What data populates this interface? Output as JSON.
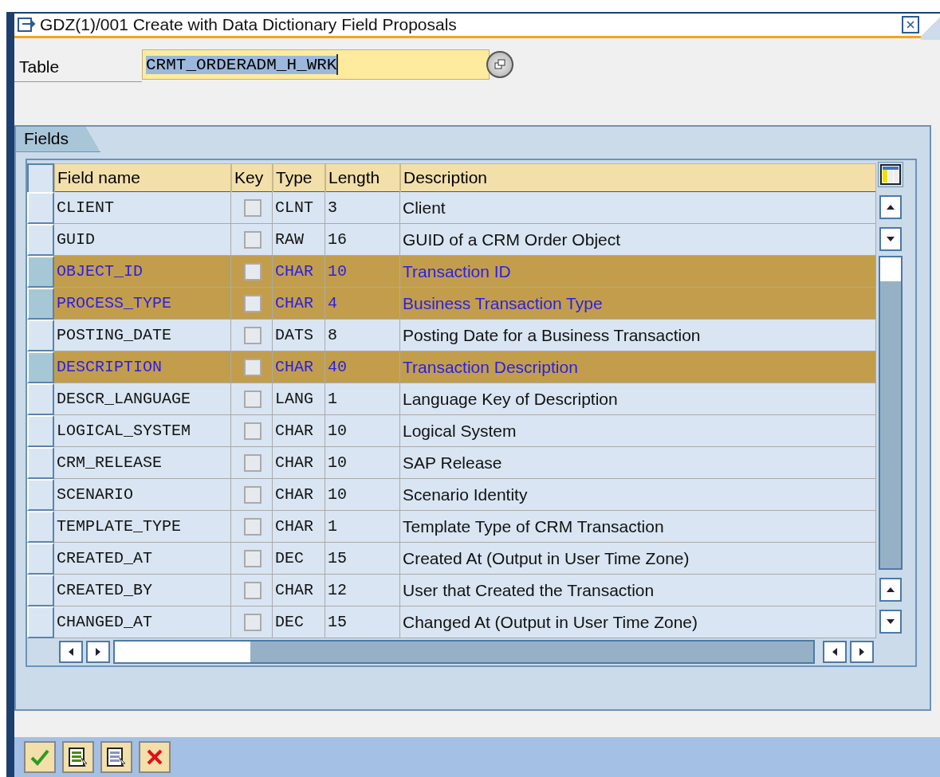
{
  "window": {
    "title": "GDZ(1)/001 Create with Data Dictionary Field Proposals"
  },
  "table_field": {
    "label": "Table",
    "value": "CRMT_ORDERADM_H_WRK",
    "value_selected": true
  },
  "group": {
    "tab": "Fields"
  },
  "columns": [
    "Field name",
    "Key",
    "Type",
    "Length",
    "Description"
  ],
  "rows": [
    {
      "field": "CLIENT",
      "key": false,
      "type": "CLNT",
      "length": "3",
      "description": "Client",
      "selected": false
    },
    {
      "field": "GUID",
      "key": false,
      "type": "RAW",
      "length": "16",
      "description": "GUID of a CRM Order Object",
      "selected": false
    },
    {
      "field": "OBJECT_ID",
      "key": false,
      "type": "CHAR",
      "length": "10",
      "description": "Transaction ID",
      "selected": true
    },
    {
      "field": "PROCESS_TYPE",
      "key": false,
      "type": "CHAR",
      "length": "4",
      "description": "Business Transaction Type",
      "selected": true
    },
    {
      "field": "POSTING_DATE",
      "key": false,
      "type": "DATS",
      "length": "8",
      "description": "Posting Date for a Business Transaction",
      "selected": false
    },
    {
      "field": "DESCRIPTION",
      "key": false,
      "type": "CHAR",
      "length": "40",
      "description": "Transaction Description",
      "selected": true
    },
    {
      "field": "DESCR_LANGUAGE",
      "key": false,
      "type": "LANG",
      "length": "1",
      "description": "Language Key of Description",
      "selected": false
    },
    {
      "field": "LOGICAL_SYSTEM",
      "key": false,
      "type": "CHAR",
      "length": "10",
      "description": "Logical System",
      "selected": false
    },
    {
      "field": "CRM_RELEASE",
      "key": false,
      "type": "CHAR",
      "length": "10",
      "description": "SAP Release",
      "selected": false
    },
    {
      "field": "SCENARIO",
      "key": false,
      "type": "CHAR",
      "length": "10",
      "description": "Scenario Identity",
      "selected": false
    },
    {
      "field": "TEMPLATE_TYPE",
      "key": false,
      "type": "CHAR",
      "length": "1",
      "description": "Template Type of CRM Transaction",
      "selected": false
    },
    {
      "field": "CREATED_AT",
      "key": false,
      "type": "DEC",
      "length": "15",
      "description": "Created At (Output in User Time Zone)",
      "selected": false
    },
    {
      "field": "CREATED_BY",
      "key": false,
      "type": "CHAR",
      "length": "12",
      "description": "User that Created the Transaction",
      "selected": false
    },
    {
      "field": "CHANGED_AT",
      "key": false,
      "type": "DEC",
      "length": "15",
      "description": "Changed At (Output in User Time Zone)",
      "selected": false
    }
  ],
  "footer_buttons": [
    {
      "kind": "confirm"
    },
    {
      "kind": "select-all"
    },
    {
      "kind": "deselect-all"
    },
    {
      "kind": "cancel"
    }
  ]
}
